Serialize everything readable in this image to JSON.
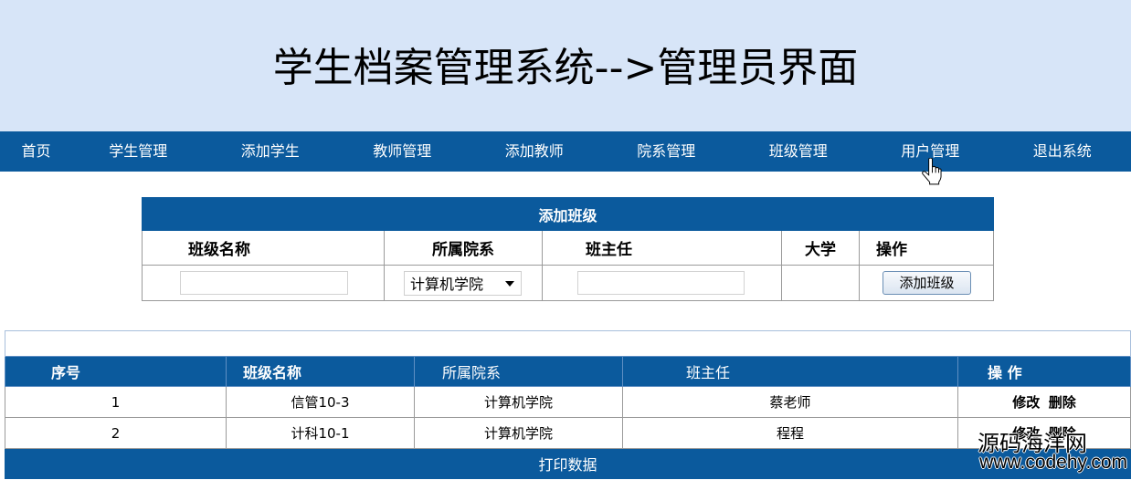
{
  "header": {
    "title": "学生档案管理系统-->管理员界面"
  },
  "nav": {
    "items": [
      "首页",
      "学生管理",
      "添加学生",
      "教师管理",
      "添加教师",
      "院系管理",
      "班级管理",
      "用户管理",
      "退出系统"
    ]
  },
  "add_class_form": {
    "title": "添加班级",
    "columns": [
      "班级名称",
      "所属院系",
      "班主任",
      "大学",
      "操作"
    ],
    "class_name_value": "",
    "department_select": {
      "selected": "计算机学院"
    },
    "head_teacher_value": "",
    "submit_label": "添加班级"
  },
  "class_table": {
    "columns": [
      "序号",
      "班级名称",
      "所属院系",
      "班主任",
      "操 作"
    ],
    "rows": [
      {
        "index": "1",
        "class_name": "信管10-3",
        "department": "计算机学院",
        "head_teacher": "蔡老师",
        "edit_label": "修改",
        "delete_label": "删除"
      },
      {
        "index": "2",
        "class_name": "计科10-1",
        "department": "计算机学院",
        "head_teacher": "程程",
        "edit_label": "修改",
        "delete_label": "删除"
      }
    ],
    "footer_label": "打印数据"
  },
  "watermark": {
    "line1": "源码海洋网",
    "line2": "www.codehy.com"
  },
  "colors": {
    "header_bg": "#d7e5f8",
    "nav_bg": "#0b5a9d",
    "nav_text": "#ffffff",
    "cell_border": "#9a9a9a"
  },
  "icons": {
    "select_arrow": "dropdown-arrow-icon",
    "pointer": "hand-cursor-icon"
  }
}
